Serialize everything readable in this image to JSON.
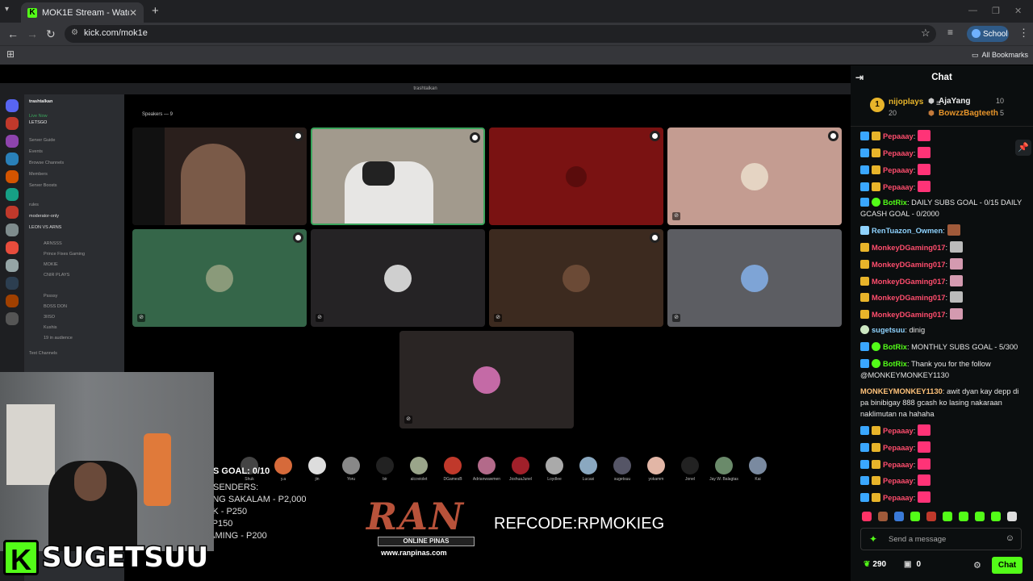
{
  "browser": {
    "tab_title": "MOK1E Stream - Watch Live",
    "tab_favicon": "K",
    "address": "kick.com/mok1e",
    "profile_label": "School",
    "all_bookmarks": "All Bookmarks",
    "icons": [
      "tab-list-icon",
      "close-icon",
      "new-tab-icon",
      "back-icon",
      "forward-icon",
      "reload-icon",
      "site-settings-icon",
      "star-icon",
      "media-icon",
      "kebab-icon",
      "apps-icon",
      "folder-icon"
    ]
  },
  "stream": {
    "discord_window_title": "trashtalkan",
    "server_name": "trashtalkan",
    "speakers_label": "Speakers — 9",
    "channels": [
      "Live Now",
      "LETSGO",
      "Server Guide",
      "Events",
      "Browse Channels",
      "Members",
      "Server Boosts",
      "rules",
      "moderator-only",
      "LEON VS ARNS",
      "ARNSSS",
      "Prince Fixes Gaming",
      "MOKIE",
      "CNIR PLAYS",
      "Pssssy",
      "BOSS DON",
      "3IISO",
      "Kushis",
      "19 in audience",
      "Text Channels"
    ],
    "audience_names": [
      "Shuk",
      "y.a",
      "jin",
      "Yoru",
      "bir",
      "alcoviolet",
      "DGamesB",
      "Adrianwawmen",
      "JoshuaJunel",
      "Loydlee",
      "Lucasi",
      "sugetsuu",
      "yokamm",
      "Jonel",
      "Jay W. Balagtas",
      "Kai"
    ],
    "goal_title": "S GOAL: 0/10",
    "goal_lines": [
      "SENDERS:",
      "ANG SAKALAM - P2,000",
      "AK - P250",
      "- P150",
      "YS TOKIO GAMING - P200"
    ],
    "ran_logo": "RAN",
    "ran_sub": "ONLINE PINAS",
    "ran_url": "www.ranpinas.com",
    "refcode": "REFCODE:RPMOKIEG",
    "streamer_plate": "SUGETSUU",
    "plate_logo": "K"
  },
  "chat": {
    "title": "Chat",
    "leaderboard": {
      "first": {
        "rank": "1",
        "name": "nijoplays",
        "count": "20"
      },
      "second": {
        "name": "AjaYang",
        "count": "10"
      },
      "third": {
        "name": "BowzzBagteeth",
        "count": "5"
      }
    },
    "messages": [
      {
        "user": "Pepaaay",
        "text": ":",
        "color": "#ff4d6d",
        "badges": [
          "sub",
          "crown"
        ],
        "emote": "heart-emote"
      },
      {
        "user": "Pepaaay",
        "text": ":",
        "color": "#ff4d6d",
        "badges": [
          "sub",
          "crown"
        ],
        "emote": "heart-emote"
      },
      {
        "user": "Pepaaay",
        "text": ":",
        "color": "#ff4d6d",
        "badges": [
          "sub",
          "crown"
        ],
        "emote": "heart-emote"
      },
      {
        "user": "Pepaaay",
        "text": ":",
        "color": "#ff4d6d",
        "badges": [
          "sub",
          "crown"
        ],
        "emote": "heart-emote"
      },
      {
        "user": "BotRix",
        "text": ": DAILY SUBS GOAL - 0/15 DAILY GCASH GOAL - 0/2000",
        "color": "#53fc18",
        "badges": [
          "sub",
          "verified"
        ]
      },
      {
        "user": "RenTuazon_Owmen",
        "text": ":",
        "color": "#8fd3ff",
        "badges": [
          "sword"
        ],
        "emote": "face-emote"
      },
      {
        "user": "MonkeyDGaming017",
        "text": ":",
        "color": "#ff4d6d",
        "badges": [
          "crown"
        ],
        "emote": "w-emote"
      },
      {
        "user": "MonkeyDGaming017",
        "text": ":",
        "color": "#ff4d6d",
        "badges": [
          "crown"
        ],
        "emote": "anime-emote"
      },
      {
        "user": "MonkeyDGaming017",
        "text": ":",
        "color": "#ff4d6d",
        "badges": [
          "crown"
        ],
        "emote": "anime-emote"
      },
      {
        "user": "MonkeyDGaming017",
        "text": ":",
        "color": "#ff4d6d",
        "badges": [
          "crown"
        ],
        "emote": "w-emote"
      },
      {
        "user": "MonkeyDGaming017",
        "text": ":",
        "color": "#ff4d6d",
        "badges": [
          "crown"
        ],
        "emote": "anime-emote"
      },
      {
        "user": "sugetsuu",
        "text": ": dinig",
        "color": "#8fd3ff",
        "badges": [
          "shield"
        ]
      },
      {
        "user": "BotRix",
        "text": ": MONTHLY SUBS GOAL - 5/300",
        "color": "#53fc18",
        "badges": [
          "sub",
          "verified"
        ]
      },
      {
        "user": "BotRix",
        "text": ": Thank you for the follow @MONKEYMONKEY1130",
        "color": "#53fc18",
        "badges": [
          "sub",
          "verified"
        ]
      },
      {
        "user": "MONKEYMONKEY1130",
        "text": ": awit dyan kay depp di pa binibigay 888 gcash ko lasing nakaraan naklimutan na hahaha",
        "color": "#ffc27a",
        "badges": []
      },
      {
        "user": "Pepaaay",
        "text": ":",
        "color": "#ff4d6d",
        "badges": [
          "sub",
          "crown"
        ],
        "emote": "heart-emote"
      },
      {
        "user": "Pepaaay",
        "text": ":",
        "color": "#ff4d6d",
        "badges": [
          "sub",
          "crown"
        ],
        "emote": "heart-emote"
      },
      {
        "user": "Pepaaay",
        "text": ":",
        "color": "#ff4d6d",
        "badges": [
          "sub",
          "crown"
        ],
        "emote": "heart-emote"
      },
      {
        "user": "Pepaaay",
        "text": ":",
        "color": "#ff4d6d",
        "badges": [
          "sub",
          "crown"
        ],
        "emote": "heart-emote"
      },
      {
        "user": "Pepaaay",
        "text": ":",
        "color": "#ff4d6d",
        "badges": [
          "sub",
          "crown"
        ],
        "emote": "heart-emote"
      }
    ],
    "placeholder": "Send a message",
    "points": "290",
    "gifts": "0",
    "chat_button": "Chat",
    "accent": "#53fc18"
  }
}
